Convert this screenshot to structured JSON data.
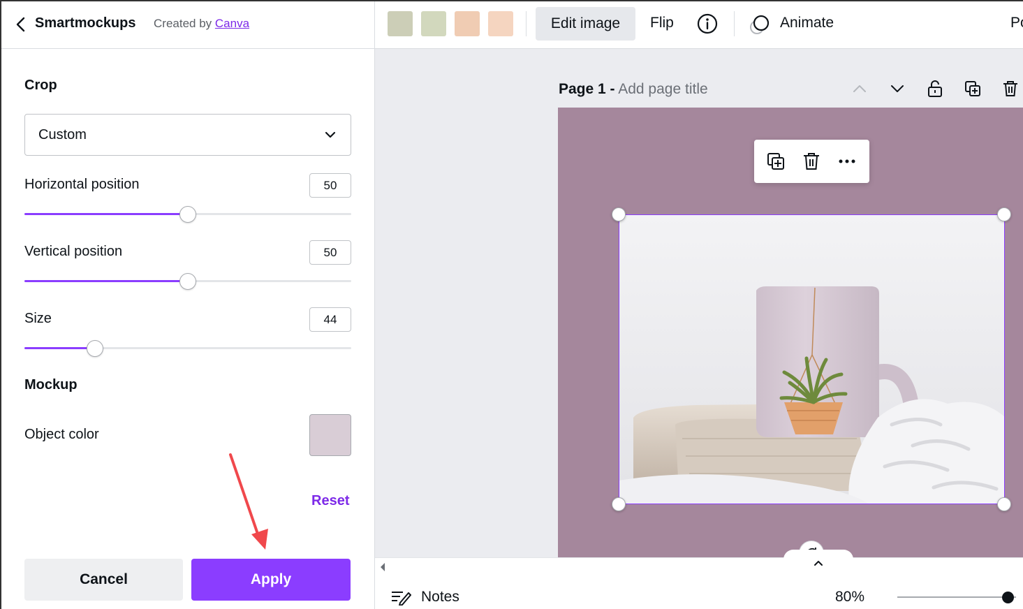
{
  "panel": {
    "back_icon": "chevron-left-icon",
    "title": "Smartmockups",
    "created_prefix": "Created by",
    "created_link": "Canva",
    "crop": {
      "heading": "Crop",
      "selected": "Custom",
      "dropdown_icon": "chevron-down-icon"
    },
    "horizontal": {
      "label": "Horizontal position",
      "value": "50",
      "level": 0.5
    },
    "vertical": {
      "label": "Vertical position",
      "value": "50",
      "level": 0.5
    },
    "size": {
      "label": "Size",
      "value": "44",
      "level": 0.216
    },
    "mockup": {
      "heading": "Mockup",
      "object_color_label": "Object color",
      "object_color": "#d9cdd6"
    },
    "reset": "Reset",
    "cancel": "Cancel",
    "apply": "Apply"
  },
  "toolbar": {
    "swatches": [
      "#ccceb7",
      "#d2d8bd",
      "#f0ccb3",
      "#f5d5c0"
    ],
    "edit_image": "Edit image",
    "flip": "Flip",
    "info_icon": "info-icon",
    "animate_icon": "animate-icon",
    "animate": "Animate",
    "position_partial": "Po"
  },
  "canvas": {
    "page_number": "Page 1 -",
    "page_title_placeholder": "Add page title",
    "page_controls": [
      "chevron-up-icon",
      "chevron-down-icon",
      "lock-icon",
      "duplicate-page-icon",
      "trash-icon"
    ],
    "page_background": "#a5879c",
    "floating_toolbar": [
      "duplicate-icon",
      "trash-icon",
      "more-icon"
    ],
    "selection_color": "#8b3dff"
  },
  "bottom": {
    "notes": "Notes",
    "zoom": "80%"
  },
  "colors": {
    "accent": "#8b3dff",
    "link": "#7d2ae8",
    "annotation_arrow": "#f0484c"
  }
}
